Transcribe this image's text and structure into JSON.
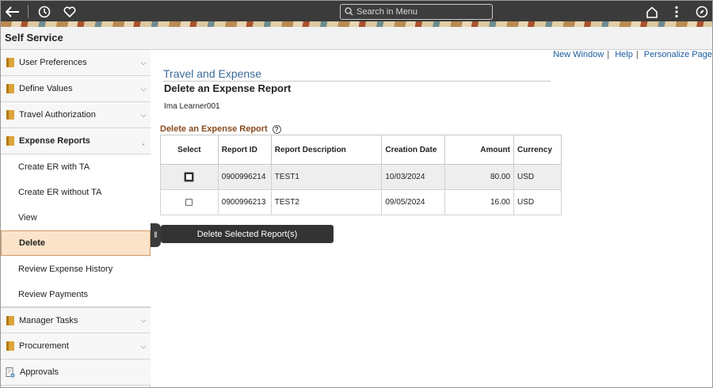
{
  "banner": {
    "search_placeholder": "Search in Menu"
  },
  "header": {
    "title": "Self Service"
  },
  "sidebar": {
    "items": [
      {
        "label": "User Preferences"
      },
      {
        "label": "Define Values"
      },
      {
        "label": "Travel Authorization"
      },
      {
        "label": "Expense Reports"
      }
    ],
    "sub_items": [
      {
        "label": "Create ER with TA"
      },
      {
        "label": "Create ER without TA"
      },
      {
        "label": "View"
      },
      {
        "label": "Delete"
      },
      {
        "label": "Review Expense History"
      },
      {
        "label": "Review Payments"
      }
    ],
    "items_after": [
      {
        "label": "Manager Tasks"
      },
      {
        "label": "Procurement"
      },
      {
        "label": "Approvals"
      }
    ]
  },
  "links": {
    "new_window": "New Window",
    "help": "Help",
    "personalize": "Personalize Page"
  },
  "content": {
    "breadcrumb": "Travel and Expense",
    "page_title": "Delete an Expense Report",
    "user": "Ima Learner001",
    "grid_title": "Delete an Expense Report",
    "columns": {
      "select": "Select",
      "report_id": "Report ID",
      "description": "Report Description",
      "creation_date": "Creation Date",
      "amount": "Amount",
      "currency": "Currency"
    },
    "rows": [
      {
        "report_id": "0900996214",
        "description": "TEST1",
        "creation_date": "10/03/2024",
        "amount": "80.00",
        "currency": "USD"
      },
      {
        "report_id": "0900996213",
        "description": "TEST2",
        "creation_date": "09/05/2024",
        "amount": "16.00",
        "currency": "USD"
      }
    ],
    "delete_button": "Delete Selected Report(s)"
  }
}
